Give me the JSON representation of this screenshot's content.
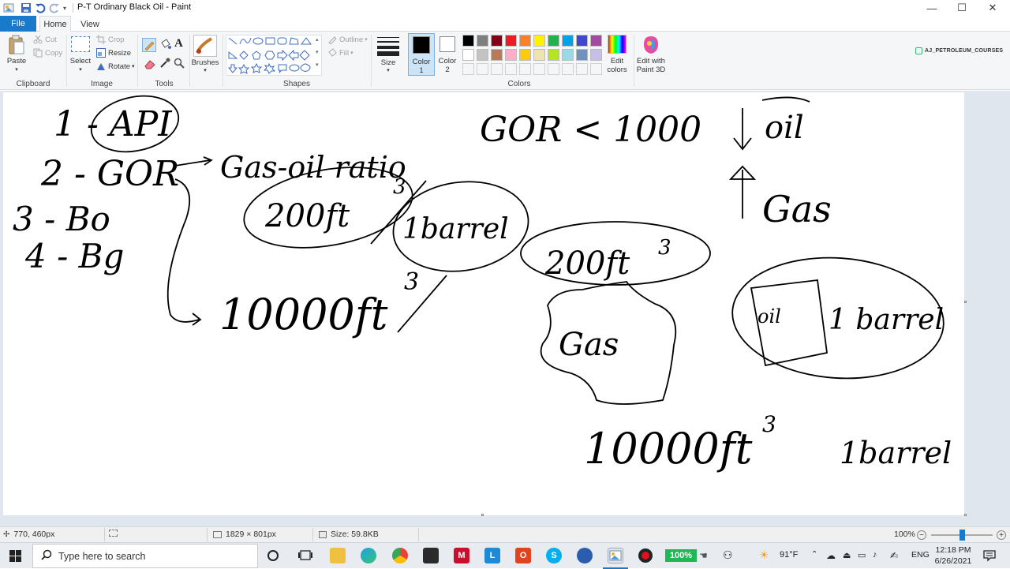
{
  "window": {
    "title": "P-T Ordinary Black Oil - Paint",
    "minimize_glyph": "—",
    "maximize_glyph": "☐",
    "close_glyph": "✕"
  },
  "tabs": {
    "file": "File",
    "home": "Home",
    "view": "View"
  },
  "ribbon": {
    "clipboard": {
      "label": "Clipboard",
      "paste": "Paste",
      "cut": "Cut",
      "copy": "Copy"
    },
    "image": {
      "label": "Image",
      "select": "Select",
      "crop": "Crop",
      "resize": "Resize",
      "rotate": "Rotate"
    },
    "tools": {
      "label": "Tools"
    },
    "brushes": {
      "label": "Brushes"
    },
    "shapes": {
      "label": "Shapes",
      "outline": "Outline",
      "fill": "Fill"
    },
    "size": {
      "label": "Size"
    },
    "color1": {
      "label1": "Color",
      "label2": "1"
    },
    "color2": {
      "label1": "Color",
      "label2": "2"
    },
    "colors": {
      "label": "Colors"
    },
    "edit_colors": {
      "label1": "Edit",
      "label2": "colors"
    },
    "paint3d": {
      "label1": "Edit with",
      "label2": "Paint 3D"
    },
    "watermark": "AJ_PETROLEUM_COURSES"
  },
  "palette": {
    "row1": [
      "#000000",
      "#7f7f7f",
      "#880015",
      "#ed1c24",
      "#ff7f27",
      "#fff200",
      "#22b14c",
      "#00a2e8",
      "#3f48cc",
      "#a349a4"
    ],
    "row2": [
      "#ffffff",
      "#c3c3c3",
      "#b97a57",
      "#ffaec9",
      "#ffc90e",
      "#efe4b0",
      "#b5e61d",
      "#99d9ea",
      "#7092be",
      "#c8bfe7"
    ]
  },
  "canvas_text": {
    "l1": "1 - API",
    "l2": "2 - GOR",
    "l3": "3 - Bo",
    "l4": "4 - Bg",
    "gas_oil_ratio": "Gas-oil ratio",
    "ft3_200": "200ft",
    "one_barrel": "1barrel",
    "ft3_10000": "10000ft",
    "sup3": "3",
    "gor_lt": "GOR < 1000",
    "oil": "oil",
    "gas": "Gas",
    "ft3_200b": "200ft",
    "gas_blob": "Gas",
    "oil_box": "oil",
    "one_barrel_b": "1 barrel",
    "ft3_10000b": "10000ft",
    "one_barrel_c": "1barrel"
  },
  "status": {
    "cursor": "770, 460px",
    "dimensions": "1829 × 801px",
    "size": "Size: 59.8KB",
    "zoom": "100%"
  },
  "taskbar": {
    "search_placeholder": "Type here to search",
    "battery_badge": "100%",
    "weather": "91°F",
    "lang": "ENG",
    "time": "12:18 PM",
    "date": "6/26/2021"
  }
}
